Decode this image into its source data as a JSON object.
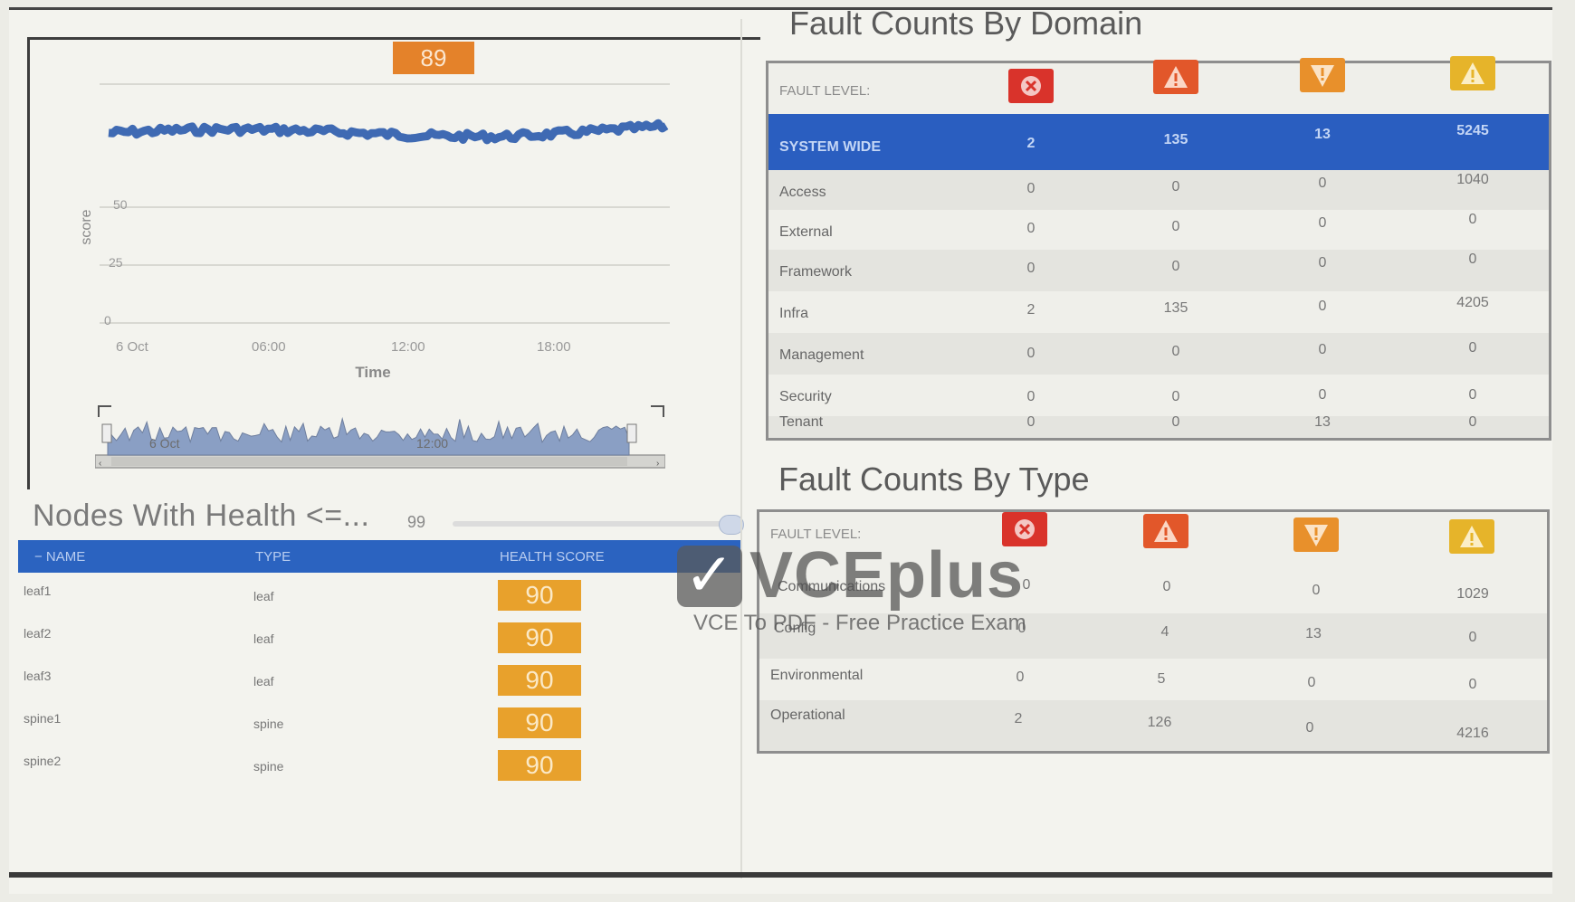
{
  "health_score": {
    "current": "89",
    "y_label": "score",
    "y_ticks": [
      "0",
      "25",
      "50"
    ],
    "x_ticks": [
      "6 Oct",
      "06:00",
      "12:00",
      "18:00"
    ],
    "x_label": "Time",
    "mini_ticks": [
      "6 Oct",
      "12:00"
    ]
  },
  "nodes": {
    "title": "Nodes With Health <=...",
    "threshold": "99",
    "columns": [
      "− NAME",
      "TYPE",
      "HEALTH SCORE"
    ],
    "rows": [
      {
        "name": "leaf1",
        "type": "leaf",
        "score": "90"
      },
      {
        "name": "leaf2",
        "type": "leaf",
        "score": "90"
      },
      {
        "name": "leaf3",
        "type": "leaf",
        "score": "90"
      },
      {
        "name": "spine1",
        "type": "spine",
        "score": "90"
      },
      {
        "name": "spine2",
        "type": "spine",
        "score": "90"
      }
    ]
  },
  "fault_domain": {
    "title": "Fault Counts By Domain",
    "level_label": "FAULT LEVEL:",
    "system_wide": {
      "label": "SYSTEM WIDE",
      "values": [
        "2",
        "135",
        "13",
        "5245"
      ]
    },
    "rows": [
      {
        "label": "Access",
        "values": [
          "0",
          "0",
          "0",
          "1040"
        ]
      },
      {
        "label": "External",
        "values": [
          "0",
          "0",
          "0",
          "0"
        ]
      },
      {
        "label": "Framework",
        "values": [
          "0",
          "0",
          "0",
          "0"
        ]
      },
      {
        "label": "Infra",
        "values": [
          "2",
          "135",
          "0",
          "4205"
        ]
      },
      {
        "label": "Management",
        "values": [
          "0",
          "0",
          "0",
          "0"
        ]
      },
      {
        "label": "Security",
        "values": [
          "0",
          "0",
          "0",
          "0"
        ]
      },
      {
        "label": "Tenant",
        "values": [
          "0",
          "0",
          "13",
          "0"
        ]
      }
    ]
  },
  "fault_type": {
    "title": "Fault Counts By Type",
    "level_label": "FAULT LEVEL:",
    "rows": [
      {
        "label": "Communications",
        "values": [
          "0",
          "0",
          "0",
          "1029"
        ]
      },
      {
        "label": "Config",
        "values": [
          "0",
          "4",
          "13",
          "0"
        ]
      },
      {
        "label": "Environmental",
        "values": [
          "0",
          "5",
          "0",
          "0"
        ]
      },
      {
        "label": "Operational",
        "values": [
          "2",
          "126",
          "0",
          "4216"
        ]
      }
    ]
  },
  "severity_icons": [
    {
      "name": "critical-icon",
      "color": "#d9332b"
    },
    {
      "name": "major-icon",
      "color": "#e2572a"
    },
    {
      "name": "minor-icon",
      "color": "#e8902b"
    },
    {
      "name": "warning-icon",
      "color": "#e6b42a"
    }
  ],
  "watermark": {
    "brand": "VCEplus",
    "tagline": "VCE To PDF - Free Practice Exam"
  }
}
